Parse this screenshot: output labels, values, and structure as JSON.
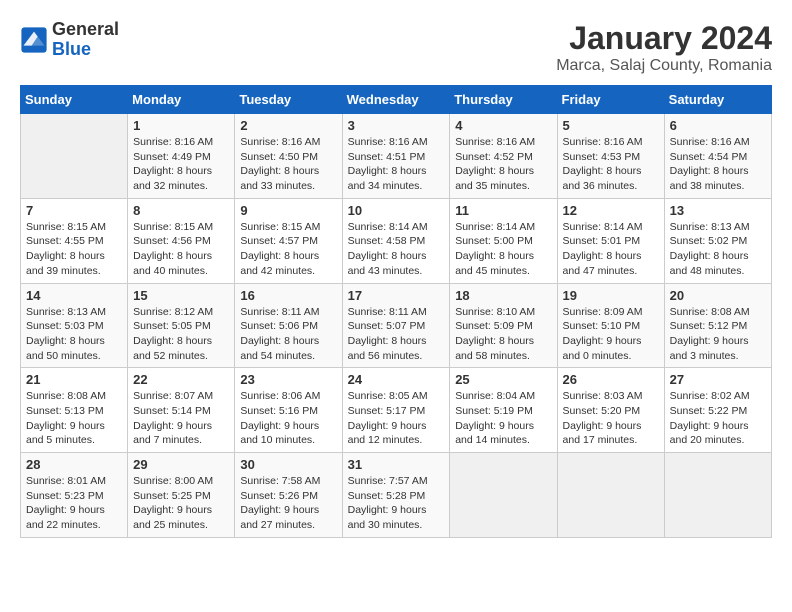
{
  "logo": {
    "general": "General",
    "blue": "Blue"
  },
  "title": "January 2024",
  "subtitle": "Marca, Salaj County, Romania",
  "days_of_week": [
    "Sunday",
    "Monday",
    "Tuesday",
    "Wednesday",
    "Thursday",
    "Friday",
    "Saturday"
  ],
  "weeks": [
    [
      {
        "day": "",
        "sunrise": "",
        "sunset": "",
        "daylight": ""
      },
      {
        "day": "1",
        "sunrise": "Sunrise: 8:16 AM",
        "sunset": "Sunset: 4:49 PM",
        "daylight": "Daylight: 8 hours and 32 minutes."
      },
      {
        "day": "2",
        "sunrise": "Sunrise: 8:16 AM",
        "sunset": "Sunset: 4:50 PM",
        "daylight": "Daylight: 8 hours and 33 minutes."
      },
      {
        "day": "3",
        "sunrise": "Sunrise: 8:16 AM",
        "sunset": "Sunset: 4:51 PM",
        "daylight": "Daylight: 8 hours and 34 minutes."
      },
      {
        "day": "4",
        "sunrise": "Sunrise: 8:16 AM",
        "sunset": "Sunset: 4:52 PM",
        "daylight": "Daylight: 8 hours and 35 minutes."
      },
      {
        "day": "5",
        "sunrise": "Sunrise: 8:16 AM",
        "sunset": "Sunset: 4:53 PM",
        "daylight": "Daylight: 8 hours and 36 minutes."
      },
      {
        "day": "6",
        "sunrise": "Sunrise: 8:16 AM",
        "sunset": "Sunset: 4:54 PM",
        "daylight": "Daylight: 8 hours and 38 minutes."
      }
    ],
    [
      {
        "day": "7",
        "sunrise": "Sunrise: 8:15 AM",
        "sunset": "Sunset: 4:55 PM",
        "daylight": "Daylight: 8 hours and 39 minutes."
      },
      {
        "day": "8",
        "sunrise": "Sunrise: 8:15 AM",
        "sunset": "Sunset: 4:56 PM",
        "daylight": "Daylight: 8 hours and 40 minutes."
      },
      {
        "day": "9",
        "sunrise": "Sunrise: 8:15 AM",
        "sunset": "Sunset: 4:57 PM",
        "daylight": "Daylight: 8 hours and 42 minutes."
      },
      {
        "day": "10",
        "sunrise": "Sunrise: 8:14 AM",
        "sunset": "Sunset: 4:58 PM",
        "daylight": "Daylight: 8 hours and 43 minutes."
      },
      {
        "day": "11",
        "sunrise": "Sunrise: 8:14 AM",
        "sunset": "Sunset: 5:00 PM",
        "daylight": "Daylight: 8 hours and 45 minutes."
      },
      {
        "day": "12",
        "sunrise": "Sunrise: 8:14 AM",
        "sunset": "Sunset: 5:01 PM",
        "daylight": "Daylight: 8 hours and 47 minutes."
      },
      {
        "day": "13",
        "sunrise": "Sunrise: 8:13 AM",
        "sunset": "Sunset: 5:02 PM",
        "daylight": "Daylight: 8 hours and 48 minutes."
      }
    ],
    [
      {
        "day": "14",
        "sunrise": "Sunrise: 8:13 AM",
        "sunset": "Sunset: 5:03 PM",
        "daylight": "Daylight: 8 hours and 50 minutes."
      },
      {
        "day": "15",
        "sunrise": "Sunrise: 8:12 AM",
        "sunset": "Sunset: 5:05 PM",
        "daylight": "Daylight: 8 hours and 52 minutes."
      },
      {
        "day": "16",
        "sunrise": "Sunrise: 8:11 AM",
        "sunset": "Sunset: 5:06 PM",
        "daylight": "Daylight: 8 hours and 54 minutes."
      },
      {
        "day": "17",
        "sunrise": "Sunrise: 8:11 AM",
        "sunset": "Sunset: 5:07 PM",
        "daylight": "Daylight: 8 hours and 56 minutes."
      },
      {
        "day": "18",
        "sunrise": "Sunrise: 8:10 AM",
        "sunset": "Sunset: 5:09 PM",
        "daylight": "Daylight: 8 hours and 58 minutes."
      },
      {
        "day": "19",
        "sunrise": "Sunrise: 8:09 AM",
        "sunset": "Sunset: 5:10 PM",
        "daylight": "Daylight: 9 hours and 0 minutes."
      },
      {
        "day": "20",
        "sunrise": "Sunrise: 8:08 AM",
        "sunset": "Sunset: 5:12 PM",
        "daylight": "Daylight: 9 hours and 3 minutes."
      }
    ],
    [
      {
        "day": "21",
        "sunrise": "Sunrise: 8:08 AM",
        "sunset": "Sunset: 5:13 PM",
        "daylight": "Daylight: 9 hours and 5 minutes."
      },
      {
        "day": "22",
        "sunrise": "Sunrise: 8:07 AM",
        "sunset": "Sunset: 5:14 PM",
        "daylight": "Daylight: 9 hours and 7 minutes."
      },
      {
        "day": "23",
        "sunrise": "Sunrise: 8:06 AM",
        "sunset": "Sunset: 5:16 PM",
        "daylight": "Daylight: 9 hours and 10 minutes."
      },
      {
        "day": "24",
        "sunrise": "Sunrise: 8:05 AM",
        "sunset": "Sunset: 5:17 PM",
        "daylight": "Daylight: 9 hours and 12 minutes."
      },
      {
        "day": "25",
        "sunrise": "Sunrise: 8:04 AM",
        "sunset": "Sunset: 5:19 PM",
        "daylight": "Daylight: 9 hours and 14 minutes."
      },
      {
        "day": "26",
        "sunrise": "Sunrise: 8:03 AM",
        "sunset": "Sunset: 5:20 PM",
        "daylight": "Daylight: 9 hours and 17 minutes."
      },
      {
        "day": "27",
        "sunrise": "Sunrise: 8:02 AM",
        "sunset": "Sunset: 5:22 PM",
        "daylight": "Daylight: 9 hours and 20 minutes."
      }
    ],
    [
      {
        "day": "28",
        "sunrise": "Sunrise: 8:01 AM",
        "sunset": "Sunset: 5:23 PM",
        "daylight": "Daylight: 9 hours and 22 minutes."
      },
      {
        "day": "29",
        "sunrise": "Sunrise: 8:00 AM",
        "sunset": "Sunset: 5:25 PM",
        "daylight": "Daylight: 9 hours and 25 minutes."
      },
      {
        "day": "30",
        "sunrise": "Sunrise: 7:58 AM",
        "sunset": "Sunset: 5:26 PM",
        "daylight": "Daylight: 9 hours and 27 minutes."
      },
      {
        "day": "31",
        "sunrise": "Sunrise: 7:57 AM",
        "sunset": "Sunset: 5:28 PM",
        "daylight": "Daylight: 9 hours and 30 minutes."
      },
      {
        "day": "",
        "sunrise": "",
        "sunset": "",
        "daylight": ""
      },
      {
        "day": "",
        "sunrise": "",
        "sunset": "",
        "daylight": ""
      },
      {
        "day": "",
        "sunrise": "",
        "sunset": "",
        "daylight": ""
      }
    ]
  ]
}
